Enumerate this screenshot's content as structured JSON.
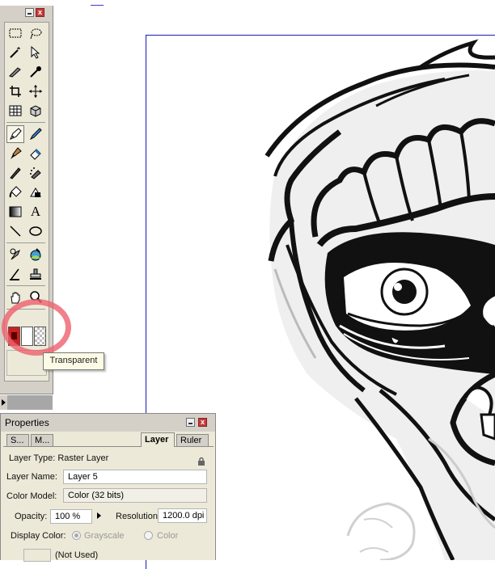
{
  "tools_panel": {
    "tools": [
      {
        "name": "marquee-tool-icon"
      },
      {
        "name": "lasso-tool-icon"
      },
      {
        "name": "magic-wand-icon"
      },
      {
        "name": "select-pen-icon"
      },
      {
        "name": "knife-icon"
      },
      {
        "name": "dropper-icon"
      },
      {
        "name": "crop-icon"
      },
      {
        "name": "transform-icon"
      },
      {
        "name": "table-icon"
      },
      {
        "name": "3d-object-icon"
      },
      {
        "name": "pen-tool-icon"
      },
      {
        "name": "pencil-icon"
      },
      {
        "name": "brush-icon"
      },
      {
        "name": "eraser-icon"
      },
      {
        "name": "calligraphy-pen-icon"
      },
      {
        "name": "airbrush-icon"
      },
      {
        "name": "fill-bucket-icon"
      },
      {
        "name": "shape-fill-icon"
      },
      {
        "name": "gradient-icon"
      },
      {
        "name": "text-tool-icon"
      },
      {
        "name": "line-tool-icon"
      },
      {
        "name": "ellipse-tool-icon"
      },
      {
        "name": "smudge-icon"
      },
      {
        "name": "color-replace-icon"
      },
      {
        "name": "scissors-icon"
      },
      {
        "name": "stamp-icon"
      },
      {
        "name": "hand-icon"
      },
      {
        "name": "zoom-icon"
      }
    ],
    "text_tool_glyph": "A",
    "close_glyph": "x",
    "tooltip": "Transparent",
    "colors": {
      "stroke": "#cc2020",
      "fill": "#ffffff"
    }
  },
  "properties": {
    "title": "Properties",
    "tabs": {
      "s": "S...",
      "m": "M...",
      "layer": "Layer",
      "ruler": "Ruler"
    },
    "layer_type": "Layer Type: Raster Layer",
    "layer_name_label": "Layer Name:",
    "layer_name_value": "Layer 5",
    "color_model_label": "Color Model:",
    "color_model_value": "Color (32 bits)",
    "opacity_label": "Opacity:",
    "opacity_value": "100 %",
    "resolution_label": "Resolution:",
    "resolution_value": "1200.0 dpi",
    "display_color_label": "Display Color:",
    "display_color_options": {
      "grayscale": "Grayscale",
      "color": "Color"
    },
    "display_color_selected": "Grayscale",
    "not_used": "(Not Used)"
  }
}
